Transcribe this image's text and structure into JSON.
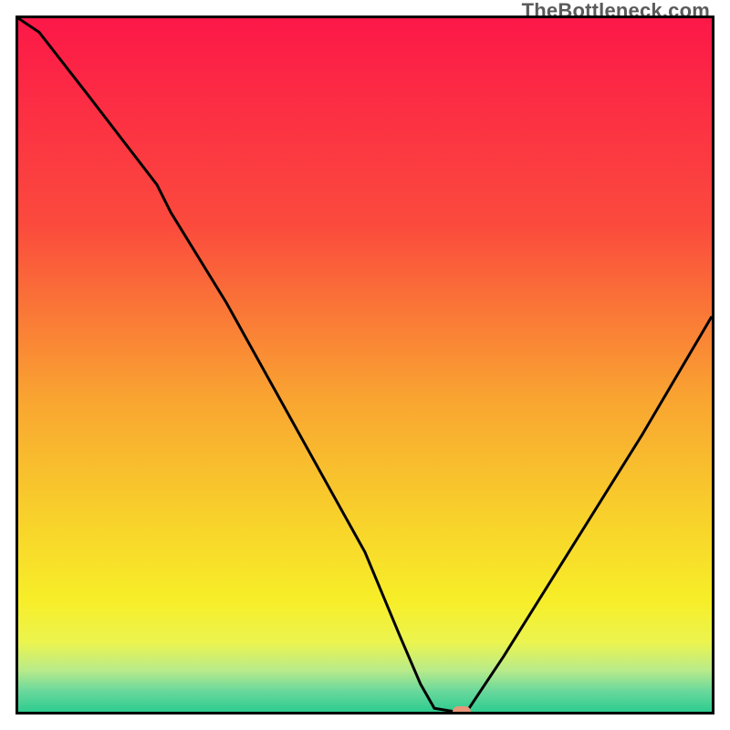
{
  "watermark": "TheBottleneck.com",
  "chart_data": {
    "type": "line",
    "title": "",
    "xlabel": "",
    "ylabel": "",
    "xlim": [
      0,
      100
    ],
    "ylim": [
      0,
      100
    ],
    "x": [
      0,
      3,
      10,
      20,
      22,
      30,
      40,
      50,
      55,
      58,
      60,
      63,
      65,
      70,
      80,
      90,
      100
    ],
    "y": [
      100,
      98,
      89,
      76,
      72,
      59,
      41,
      23,
      11,
      4,
      0.5,
      0,
      0.5,
      8,
      24,
      40,
      57
    ],
    "marker": {
      "x": 64,
      "y": 0
    },
    "gradient_stops": [
      {
        "pos": 0.0,
        "color": "#fc1848"
      },
      {
        "pos": 0.3,
        "color": "#fb4b3d"
      },
      {
        "pos": 0.55,
        "color": "#f9a531"
      },
      {
        "pos": 0.72,
        "color": "#f8d12b"
      },
      {
        "pos": 0.84,
        "color": "#f7ee28"
      },
      {
        "pos": 0.9,
        "color": "#ebf44f"
      },
      {
        "pos": 0.94,
        "color": "#b9eb8a"
      },
      {
        "pos": 0.97,
        "color": "#6ad89c"
      },
      {
        "pos": 1.0,
        "color": "#2ecc8f"
      }
    ]
  }
}
